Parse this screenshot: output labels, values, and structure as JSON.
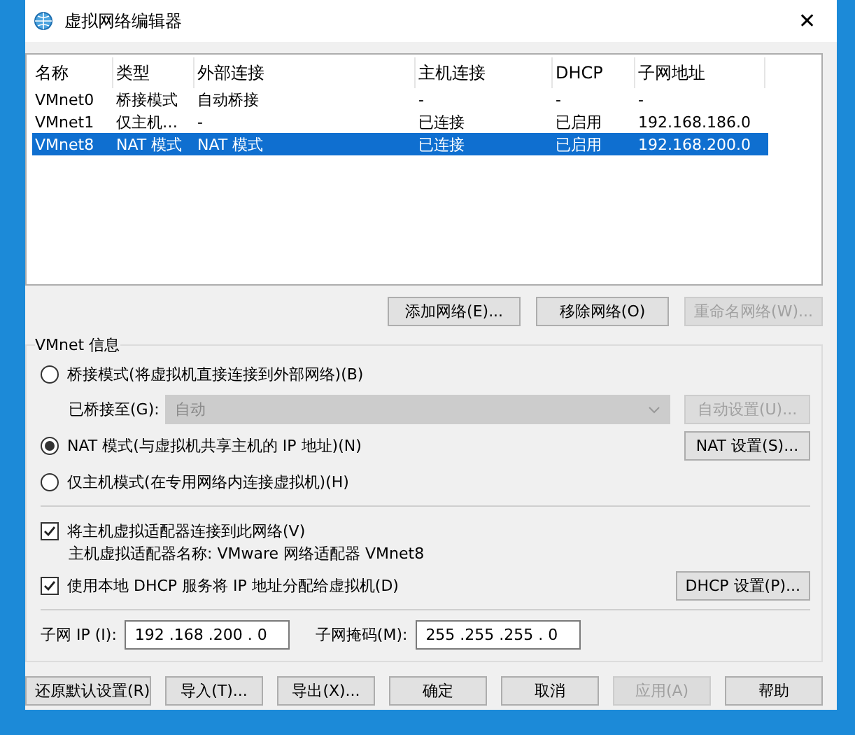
{
  "window": {
    "title": "虚拟网络编辑器",
    "close": "✕"
  },
  "table": {
    "columns": [
      "名称",
      "类型",
      "外部连接",
      "主机连接",
      "DHCP",
      "子网地址"
    ],
    "rows": [
      {
        "cells": [
          "VMnet0",
          "桥接模式",
          "自动桥接",
          "-",
          "-",
          "-"
        ],
        "selected": false
      },
      {
        "cells": [
          "VMnet1",
          "仅主机…",
          "-",
          "已连接",
          "已启用",
          "192.168.186.0"
        ],
        "selected": false
      },
      {
        "cells": [
          "VMnet8",
          "NAT 模式",
          "NAT 模式",
          "已连接",
          "已启用",
          "192.168.200.0"
        ],
        "selected": true
      }
    ]
  },
  "list_buttons": [
    {
      "label": "添加网络(E)...",
      "disabled": false
    },
    {
      "label": "移除网络(O)",
      "disabled": false
    },
    {
      "label": "重命名网络(W)...",
      "disabled": true
    }
  ],
  "vmnet_info": {
    "title": "VMnet 信息",
    "modes": [
      {
        "label": "桥接模式(将虚拟机直接连接到外部网络)(B)",
        "selected": false,
        "target": {
          "label": "已桥接至(G):",
          "value": "自动",
          "disabled": true,
          "button": {
            "label": "自动设置(U)...",
            "disabled": true
          }
        }
      },
      {
        "label": "NAT 模式(与虚拟机共享主机的 IP 地址)(N)",
        "selected": true,
        "button": {
          "label": "NAT 设置(S)...",
          "disabled": false
        }
      },
      {
        "label": "仅主机模式(在专用网络内连接虚拟机)(H)",
        "selected": false
      }
    ],
    "connect_adapter": {
      "label": "将主机虚拟适配器连接到此网络(V)",
      "checked": true
    },
    "adapter_name": "主机虚拟适配器名称: VMware 网络适配器 VMnet8",
    "dhcp": {
      "label": "使用本地 DHCP 服务将 IP 地址分配给虚拟机(D)",
      "checked": true,
      "button": {
        "label": "DHCP 设置(P)...",
        "disabled": false
      }
    },
    "subnet_ip": {
      "label": "子网 IP (I):",
      "value": "192 .168 .200 . 0"
    },
    "subnet_mask": {
      "label": "子网掩码(M):",
      "value": "255 .255 .255 . 0"
    }
  },
  "footer_buttons": [
    {
      "label": "还原默认设置(R)",
      "disabled": false
    },
    {
      "label": "导入(T)...",
      "disabled": false
    },
    {
      "label": "导出(X)...",
      "disabled": false
    },
    {
      "label": "确定",
      "disabled": false
    },
    {
      "label": "取消",
      "disabled": false
    },
    {
      "label": "应用(A)",
      "disabled": true
    },
    {
      "label": "帮助",
      "disabled": false
    }
  ]
}
